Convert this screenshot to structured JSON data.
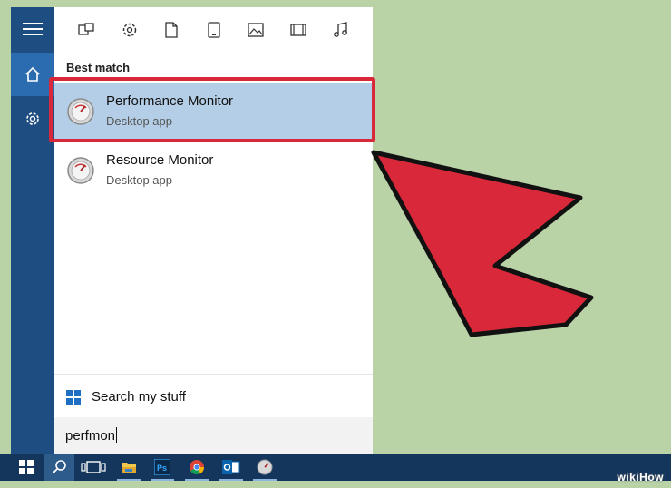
{
  "panel": {
    "section_label": "Best match",
    "results": [
      {
        "title": "Performance Monitor",
        "subtitle": "Desktop app",
        "selected": true
      },
      {
        "title": "Resource Monitor",
        "subtitle": "Desktop app",
        "selected": false
      }
    ],
    "search_my_stuff_label": "Search my stuff",
    "search_query": "perfmon"
  },
  "rail": {
    "items": [
      "hamburger-menu-icon",
      "home-icon",
      "settings-gear-icon"
    ]
  },
  "filters": [
    "apps-icon",
    "settings-icon",
    "documents-icon",
    "tablet-icon",
    "photos-icon",
    "videos-icon",
    "music-icon"
  ],
  "taskbar": {
    "items": [
      "windows-start-icon",
      "search-icon",
      "task-view-icon",
      "file-explorer-icon",
      "photoshop-icon",
      "chrome-icon",
      "outlook-icon",
      "performance-monitor-icon"
    ]
  },
  "watermark": "wikiHow",
  "colors": {
    "accent": "#1e4d82",
    "selected_result": "#b3cee6",
    "highlight_box": "#d8283a",
    "arrow": "#d8283a",
    "background": "#b9d2a6"
  }
}
